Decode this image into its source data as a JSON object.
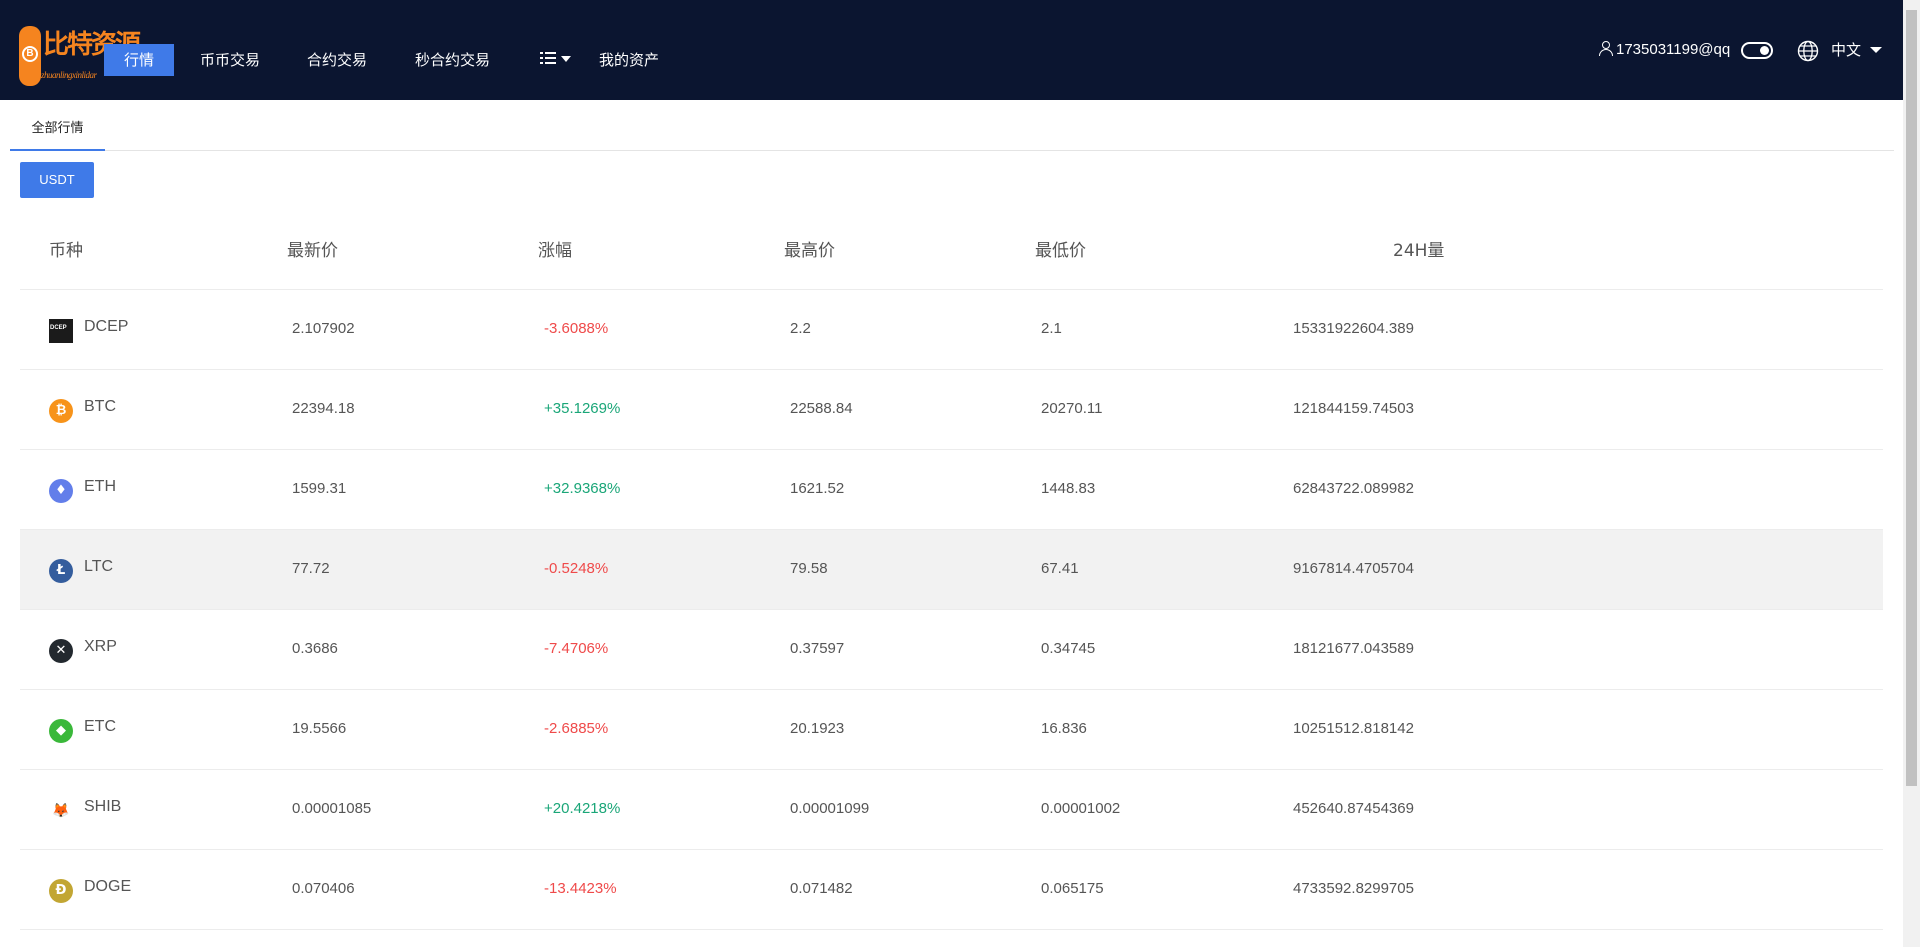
{
  "brand": {
    "name": "比特资源",
    "subtitle": "zhuanlingxinlidar",
    "badge_glyph": "B",
    "color": "#f5841f"
  },
  "nav": {
    "items": [
      {
        "label": "行情",
        "active": true
      },
      {
        "label": "币币交易"
      },
      {
        "label": "合约交易"
      },
      {
        "label": "秒合约交易"
      },
      {
        "label": "我的资产"
      }
    ],
    "menu_icon": "list-icon"
  },
  "user": {
    "account": "1735031199@qq",
    "icon": "user-icon"
  },
  "language": {
    "label": "中文",
    "icon": "globe-icon"
  },
  "tabs": [
    {
      "label": "全部行情",
      "active": true
    }
  ],
  "quote_button": {
    "label": "USDT"
  },
  "table": {
    "headers": [
      "币种",
      "最新价",
      "涨幅",
      "最高价",
      "最低价",
      "24H量"
    ],
    "rows": [
      {
        "coin": "DCEP",
        "icon": "dcep-icon",
        "icon_text": "DCEP",
        "price": "2.107902",
        "change": "-3.6088%",
        "direction": "down",
        "high": "2.2",
        "low": "2.1",
        "volume": "15331922604.389"
      },
      {
        "coin": "BTC",
        "icon": "btc-icon",
        "icon_text": "₿",
        "price": "22394.18",
        "change": "+35.1269%",
        "direction": "up",
        "high": "22588.84",
        "low": "20270.11",
        "volume": "121844159.74503"
      },
      {
        "coin": "ETH",
        "icon": "eth-icon",
        "icon_text": "♦",
        "price": "1599.31",
        "change": "+32.9368%",
        "direction": "up",
        "high": "1621.52",
        "low": "1448.83",
        "volume": "62843722.089982"
      },
      {
        "coin": "LTC",
        "icon": "ltc-icon",
        "icon_text": "Ł",
        "price": "77.72",
        "change": "-0.5248%",
        "direction": "down",
        "high": "79.58",
        "low": "67.41",
        "volume": "9167814.4705704",
        "hover": true
      },
      {
        "coin": "XRP",
        "icon": "xrp-icon",
        "icon_text": "✕",
        "price": "0.3686",
        "change": "-7.4706%",
        "direction": "down",
        "high": "0.37597",
        "low": "0.34745",
        "volume": "18121677.043589"
      },
      {
        "coin": "ETC",
        "icon": "etc-icon",
        "icon_text": "◆",
        "price": "19.5566",
        "change": "-2.6885%",
        "direction": "down",
        "high": "20.1923",
        "low": "16.836",
        "volume": "10251512.818142"
      },
      {
        "coin": "SHIB",
        "icon": "shib-icon",
        "icon_text": "🦊",
        "price": "0.00001085",
        "change": "+20.4218%",
        "direction": "up",
        "high": "0.00001099",
        "low": "0.00001002",
        "volume": "452640.87454369"
      },
      {
        "coin": "DOGE",
        "icon": "doge-icon",
        "icon_text": "Ð",
        "price": "0.070406",
        "change": "-13.4423%",
        "direction": "down",
        "high": "0.071482",
        "low": "0.065175",
        "volume": "4733592.8299705"
      }
    ]
  },
  "colors": {
    "navbar": "#0b1530",
    "accent": "#3f7ae8",
    "up": "#1aa678",
    "down": "#ef4a4a"
  }
}
